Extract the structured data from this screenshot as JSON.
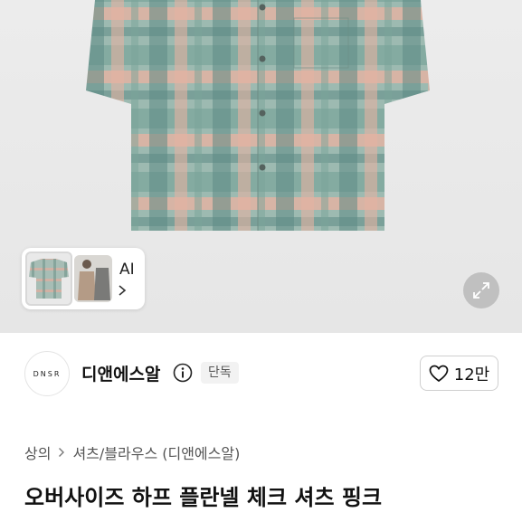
{
  "product": {
    "title": "오버사이즈 하프 플란넬 체크 셔츠 핑크",
    "thumbnails": {
      "ai_label": "AI",
      "selected_index": 0,
      "count": 2
    }
  },
  "seller": {
    "logo_text": "DNSR",
    "name": "디앤에스알",
    "badge": "단독"
  },
  "likes": {
    "count_label": "12만"
  },
  "breadcrumb": {
    "items": [
      "상의",
      "셔츠/블라우스 (디앤에스알)"
    ]
  },
  "colors": {
    "plaid_green": "#7fa69a",
    "plaid_pink": "#dba99a",
    "plaid_teal": "#5f8c86",
    "background": "#ebebeb"
  },
  "icons": {
    "zoom": "expand-icon",
    "info": "info-icon",
    "heart": "heart-outline-icon",
    "chevron": "chevron-right-icon"
  }
}
